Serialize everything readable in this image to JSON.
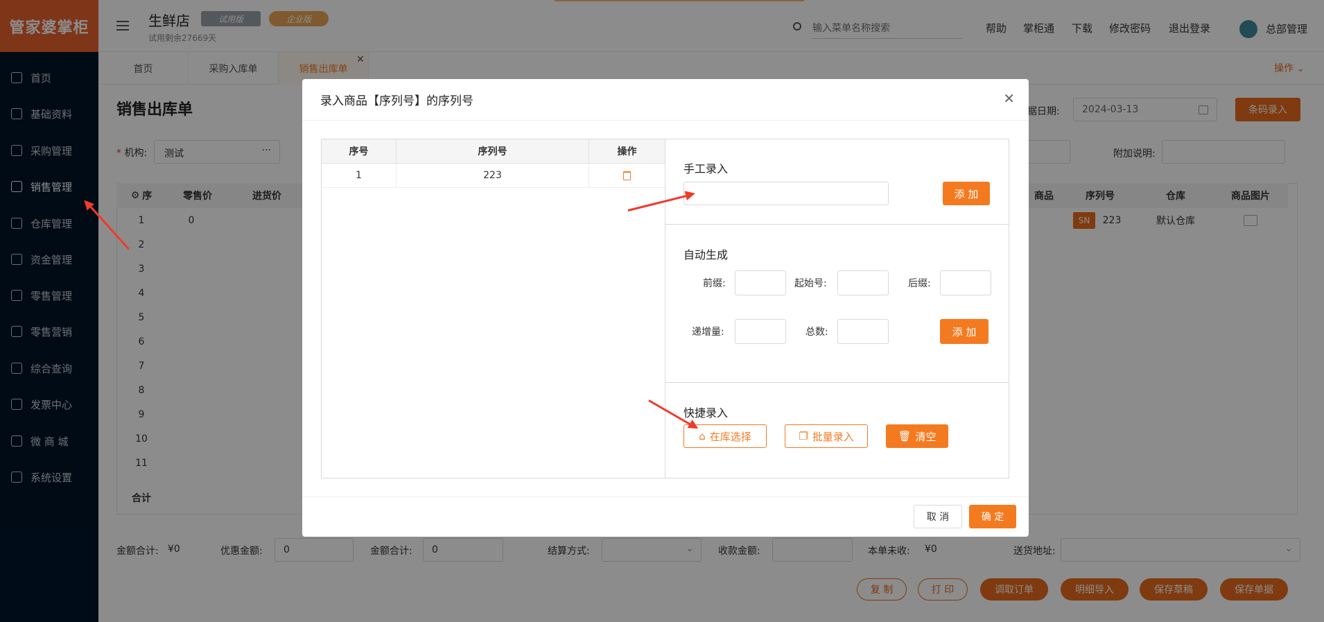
{
  "app": {
    "logo_text": "管家婆掌柜",
    "store_name": "生鲜店",
    "badge_trial": "试用版",
    "badge_enterprise": "企业版",
    "trial_remaining": "试用剩余27669天"
  },
  "header": {
    "search_placeholder": "输入菜单名称搜索",
    "links": [
      "帮助",
      "掌柜通",
      "下载",
      "修改密码",
      "退出登录"
    ],
    "user": "总部管理"
  },
  "sidebar": {
    "items": [
      {
        "label": "首页",
        "icon": "globe-icon"
      },
      {
        "label": "基础资料",
        "icon": "home-icon"
      },
      {
        "label": "采购管理",
        "icon": "cart-icon"
      },
      {
        "label": "销售管理",
        "icon": "sales-icon"
      },
      {
        "label": "仓库管理",
        "icon": "warehouse-icon"
      },
      {
        "label": "资金管理",
        "icon": "money-icon"
      },
      {
        "label": "零售管理",
        "icon": "retail-icon"
      },
      {
        "label": "零售营销",
        "icon": "gift-icon"
      },
      {
        "label": "综合查询",
        "icon": "chart-icon"
      },
      {
        "label": "发票中心",
        "icon": "invoice-icon"
      },
      {
        "label": "微 商 城",
        "icon": "shop-icon"
      },
      {
        "label": "系统设置",
        "icon": "gear-icon"
      }
    ],
    "active": "销售管理"
  },
  "tabs": [
    "首页",
    "采购入库单",
    "销售出库单"
  ],
  "tabs_action": "操作",
  "page": {
    "title": "销售出库单",
    "org_label": "机构:",
    "org_value": "测试",
    "date_label": "单据日期:",
    "date_value": "2024-03-13",
    "barcode_btn": "条码录入",
    "note_label": "附加说明:",
    "table_headers_left": [
      "序",
      "零售价",
      "进货价"
    ],
    "table_headers_right": [
      "商品",
      "序列号",
      "仓库",
      "商品图片"
    ],
    "row_numbers": [
      "1",
      "2",
      "3",
      "4",
      "5",
      "6",
      "7",
      "8",
      "9",
      "10",
      "11"
    ],
    "row1": {
      "retail_price": "0",
      "sn_tag": "SN",
      "serial": "223",
      "warehouse": "默认仓库"
    },
    "total_label": "合计",
    "footer": {
      "amount_total_label": "金额合计:",
      "amount_total_value": "¥0",
      "discount_label": "优惠金额:",
      "discount_value": "0",
      "amount_total2_label": "金额合计:",
      "amount_total2_value": "0",
      "settle_label": "结算方式:",
      "receive_label": "收款金额:",
      "unpaid_label": "本单未收:",
      "unpaid_value": "¥0",
      "address_label": "送货地址:"
    },
    "bottom_buttons": [
      "复 制",
      "打 印",
      "调取订单",
      "明细导入",
      "保存草稿",
      "保存单据"
    ]
  },
  "modal": {
    "title": "录入商品【序列号】的序列号",
    "table_headers": [
      "序号",
      "序列号",
      "操作"
    ],
    "rows": [
      {
        "index": "1",
        "serial": "223"
      }
    ],
    "manual_title": "手工录入",
    "manual_input_value": "",
    "add_label": "添 加",
    "auto_title": "自动生成",
    "prefix_label": "前缀:",
    "start_label": "起始号:",
    "suffix_label": "后缀:",
    "step_label": "递增量:",
    "count_label": "总数:",
    "quick_title": "快捷录入",
    "stock_select": "在库选择",
    "batch_input": "批量录入",
    "clear": "清空",
    "cancel": "取 消",
    "confirm": "确 定"
  }
}
